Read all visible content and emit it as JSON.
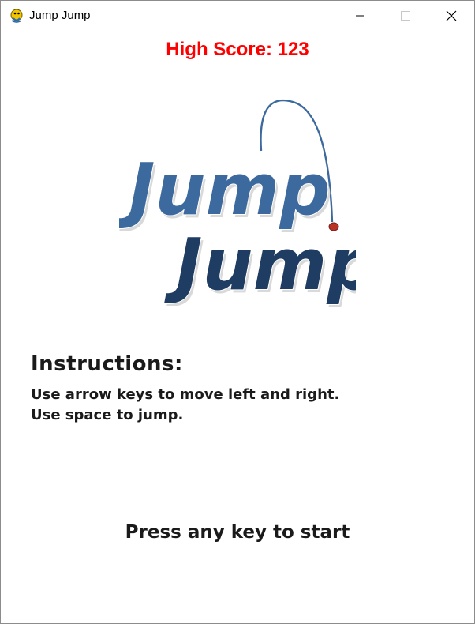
{
  "window": {
    "title": "Jump Jump",
    "icon": "pygame-snake-icon"
  },
  "controls": {
    "minimize_icon": "minimize-icon",
    "maximize_icon": "maximize-icon",
    "close_icon": "close-icon"
  },
  "game": {
    "high_score_text": "High Score: 123",
    "logo_line1": "Jump",
    "logo_line2": "Jump",
    "instructions_title": "Instructions:",
    "instructions": [
      "Use arrow keys to move left and right.",
      "Use space to jump."
    ],
    "start_prompt": "Press any key to start"
  },
  "colors": {
    "high_score": "#ff0000",
    "logo_top": "#3d6a9e",
    "logo_bottom": "#1f3d63",
    "logo_arc": "#3d6a9e",
    "logo_ball": "#b83226",
    "text": "#1a1a1a"
  }
}
